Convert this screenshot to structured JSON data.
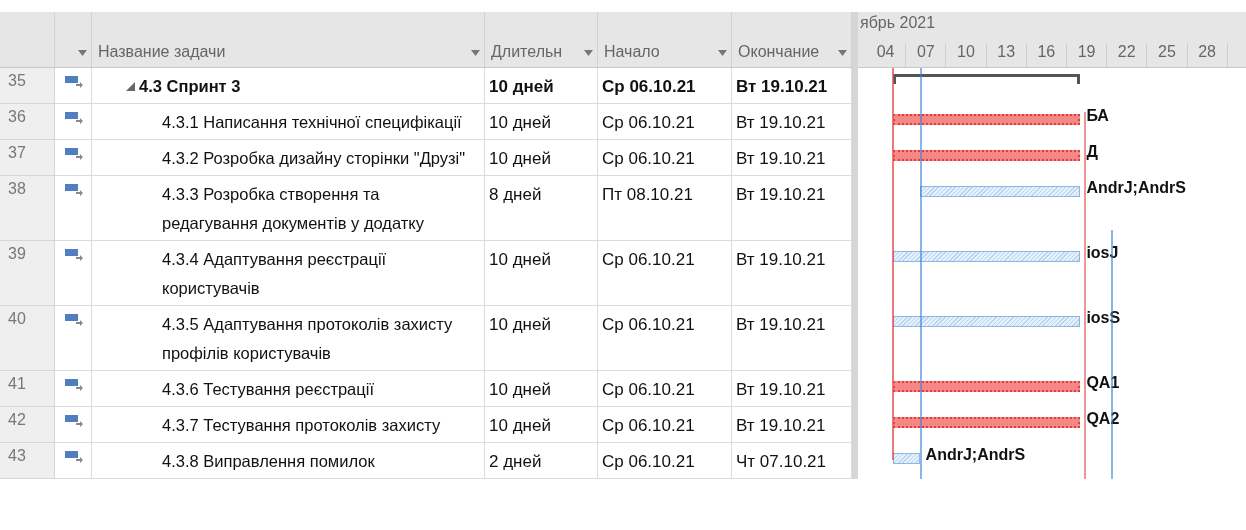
{
  "columns": {
    "name": "Название задачи",
    "duration": "Длительн",
    "start": "Начало",
    "end": "Окончание"
  },
  "timescale": {
    "month": "ябрь 2021",
    "days": [
      "04",
      "07",
      "10",
      "13",
      "16",
      "19",
      "22",
      "25",
      "28"
    ]
  },
  "tasks": [
    {
      "num": "35",
      "kind": "summary",
      "expanded": true,
      "name": "4.3 Спринт 3",
      "duration": "10 дней",
      "start": "Ср 06.10.21",
      "end": "Вт 19.10.21",
      "children": [
        {
          "num": "36",
          "kind": "task",
          "critical": true,
          "name": "4.3.1 Написання технічної специфікації",
          "duration": "10 дней",
          "start": "Ср 06.10.21",
          "end": "Вт 19.10.21",
          "resources": "БА"
        },
        {
          "num": "37",
          "kind": "task",
          "critical": true,
          "name": "4.3.2 Розробка дизайну сторінки \"Друзі\"",
          "duration": "10 дней",
          "start": "Ср 06.10.21",
          "end": "Вт 19.10.21",
          "resources": "Д"
        },
        {
          "num": "38",
          "kind": "task",
          "critical": false,
          "name": "4.3.3 Розробка створення та редагування документів у додатку",
          "duration": "8 дней",
          "start": "Пт 08.10.21",
          "end": "Вт 19.10.21",
          "resources": "AndrJ;AndrS"
        },
        {
          "num": "39",
          "kind": "task",
          "critical": false,
          "name": "4.3.4 Адаптування реєстрації користувачів",
          "duration": "10 дней",
          "start": "Ср 06.10.21",
          "end": "Вт 19.10.21",
          "resources": "iosJ"
        },
        {
          "num": "40",
          "kind": "task",
          "critical": false,
          "name": "4.3.5 Адаптування протоколів захисту профілів користувачів",
          "duration": "10 дней",
          "start": "Ср 06.10.21",
          "end": "Вт 19.10.21",
          "resources": "iosS"
        },
        {
          "num": "41",
          "kind": "task",
          "critical": true,
          "name": "4.3.6 Тестування реєстрації",
          "duration": "10 дней",
          "start": "Ср 06.10.21",
          "end": "Вт 19.10.21",
          "resources": "QA1"
        },
        {
          "num": "42",
          "kind": "task",
          "critical": true,
          "name": "4.3.7 Тестування протоколів захисту",
          "duration": "10 дней",
          "start": "Ср 06.10.21",
          "end": "Вт 19.10.21",
          "resources": "QA2"
        },
        {
          "num": "43",
          "kind": "task",
          "critical": false,
          "name": "4.3.8 Виправлення помилок",
          "duration": "2 дней",
          "start": "Ср 06.10.21",
          "end": "Чт 07.10.21",
          "resources": "AndrJ;AndrS"
        }
      ]
    }
  ]
}
